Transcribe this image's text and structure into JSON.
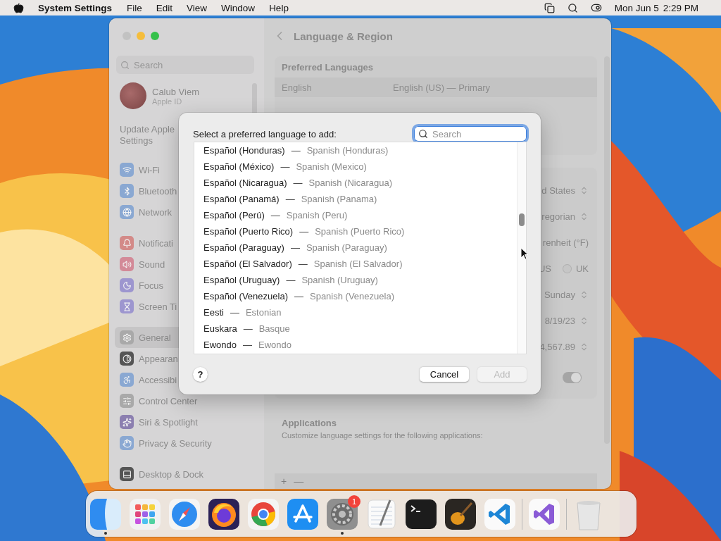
{
  "menubar": {
    "app": "System Settings",
    "menus": [
      "File",
      "Edit",
      "View",
      "Window",
      "Help"
    ],
    "date": "Mon Jun 5",
    "time": "2:29 PM"
  },
  "sidebar": {
    "search_placeholder": "Search",
    "account": {
      "name": "Calub Viem",
      "subtitle": "Apple ID"
    },
    "notice_lines": [
      "Update Apple",
      "Settings"
    ],
    "groups": [
      [
        {
          "kind": "wifi",
          "label": "Wi-Fi",
          "selected": false
        },
        {
          "kind": "bluetooth",
          "label": "Bluetooth",
          "selected": false
        },
        {
          "kind": "network",
          "label": "Network",
          "selected": false
        }
      ],
      [
        {
          "kind": "notifications",
          "label": "Notificati",
          "selected": false
        },
        {
          "kind": "sound",
          "label": "Sound",
          "selected": false
        },
        {
          "kind": "focus",
          "label": "Focus",
          "selected": false
        },
        {
          "kind": "screentime",
          "label": "Screen Ti",
          "selected": false
        }
      ],
      [
        {
          "kind": "general",
          "label": "General",
          "selected": true
        },
        {
          "kind": "appearance",
          "label": "Appearan",
          "selected": false
        },
        {
          "kind": "accessibility",
          "label": "Accessibi",
          "selected": false
        },
        {
          "kind": "controlcenter",
          "label": "Control Center",
          "selected": false
        },
        {
          "kind": "siri",
          "label": "Siri & Spotlight",
          "selected": false
        },
        {
          "kind": "privacy",
          "label": "Privacy & Security",
          "selected": false
        }
      ],
      [
        {
          "kind": "desktop",
          "label": "Desktop & Dock",
          "selected": false
        }
      ]
    ]
  },
  "content": {
    "title": "Language & Region",
    "preferred": {
      "heading": "Preferred Languages",
      "rows": [
        {
          "name": "English",
          "detail": "English (US) — Primary"
        }
      ]
    },
    "region_rows": [
      {
        "kind": "popup",
        "value": "d States"
      },
      {
        "kind": "popup",
        "value": "regorian"
      },
      {
        "kind": "text",
        "value": "renheit (°F)"
      },
      {
        "kind": "radio",
        "options": [
          {
            "label": "US"
          },
          {
            "label": "UK",
            "selected": false
          }
        ]
      },
      {
        "kind": "popup",
        "value": "Sunday"
      },
      {
        "kind": "popup",
        "value": "8/19/23"
      },
      {
        "kind": "popup",
        "value": "4,567.89"
      },
      {
        "kind": "toggle",
        "on": true
      }
    ],
    "applications": {
      "heading": "Applications",
      "subtitle": "Customize language settings for the following applications:"
    },
    "footer": {
      "add": "+",
      "remove": "—"
    }
  },
  "dialog": {
    "title": "Select a preferred language to add:",
    "search_placeholder": "Search",
    "languages": [
      {
        "native": "Español (Honduras)",
        "separator": "—",
        "english": "Spanish (Honduras)"
      },
      {
        "native": "Español (México)",
        "separator": "—",
        "english": "Spanish (Mexico)"
      },
      {
        "native": "Español (Nicaragua)",
        "separator": "—",
        "english": "Spanish (Nicaragua)"
      },
      {
        "native": "Español (Panamá)",
        "separator": "—",
        "english": "Spanish (Panama)"
      },
      {
        "native": "Español (Perú)",
        "separator": "—",
        "english": "Spanish (Peru)"
      },
      {
        "native": "Español (Puerto Rico)",
        "separator": "—",
        "english": "Spanish (Puerto Rico)"
      },
      {
        "native": "Español (Paraguay)",
        "separator": "—",
        "english": "Spanish (Paraguay)"
      },
      {
        "native": "Español (El Salvador)",
        "separator": "—",
        "english": "Spanish (El Salvador)"
      },
      {
        "native": "Español (Uruguay)",
        "separator": "—",
        "english": "Spanish (Uruguay)"
      },
      {
        "native": "Español (Venezuela)",
        "separator": "—",
        "english": "Spanish (Venezuela)"
      },
      {
        "native": "Eesti",
        "separator": "—",
        "english": "Estonian"
      },
      {
        "native": "Euskara",
        "separator": "—",
        "english": "Basque"
      },
      {
        "native": "Ewondo",
        "separator": "—",
        "english": "Ewondo"
      }
    ],
    "help": "?",
    "buttons": [
      {
        "label": "Cancel",
        "disabled": false
      },
      {
        "label": "Add",
        "disabled": true
      }
    ]
  },
  "dock": {
    "apps": [
      {
        "kind": "finder",
        "running": true
      },
      {
        "kind": "launchpad",
        "running": false
      },
      {
        "kind": "safari",
        "running": false
      },
      {
        "kind": "firefox",
        "running": false
      },
      {
        "kind": "chrome",
        "running": false
      },
      {
        "kind": "appstore",
        "running": false
      },
      {
        "kind": "settings",
        "running": true,
        "badge": "1"
      },
      {
        "kind": "textedit",
        "running": false
      },
      {
        "kind": "terminal",
        "running": false
      },
      {
        "kind": "garageband",
        "running": false
      },
      {
        "kind": "vscode",
        "running": false
      },
      {
        "kind": "separator"
      },
      {
        "kind": "visualstudio",
        "running": false
      },
      {
        "kind": "separator"
      },
      {
        "kind": "trash",
        "running": false
      }
    ]
  }
}
